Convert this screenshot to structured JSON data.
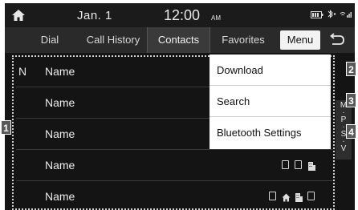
{
  "status": {
    "date": "Jan.  1",
    "time": "12:00",
    "ampm": "AM",
    "icons": [
      "battery-icon",
      "bluetooth-icon",
      "signal-icon"
    ]
  },
  "tabs": [
    {
      "label": "Dial"
    },
    {
      "label": "Call History"
    },
    {
      "label": "Contacts"
    },
    {
      "label": "Favorites"
    }
  ],
  "menu_label": "Menu",
  "contacts": [
    {
      "letter": "N",
      "name": "Name",
      "icons": []
    },
    {
      "letter": "",
      "name": "Name",
      "icons": []
    },
    {
      "letter": "",
      "name": "Name",
      "icons": []
    },
    {
      "letter": "",
      "name": "Name",
      "icons": [
        "phone-icon",
        "phone-icon",
        "office-icon"
      ]
    },
    {
      "letter": "",
      "name": "Name",
      "icons": [
        "phone-icon",
        "home-icon",
        "office-icon",
        "phone-icon"
      ]
    }
  ],
  "menu_items": [
    {
      "label": "Download"
    },
    {
      "label": "Search"
    },
    {
      "label": "Bluetooth Settings"
    }
  ],
  "index_letters": "M\n·\nP\n·\nS\n·\nV",
  "callouts": [
    "1",
    "2",
    "3",
    "4"
  ],
  "colors": {
    "background": "#141414",
    "tabbar": "#2a2a2a",
    "active_tab": "#3a3a3a",
    "menu_button": "#f2f2f2",
    "dropdown": "#ffffff",
    "callout": "#595959"
  }
}
